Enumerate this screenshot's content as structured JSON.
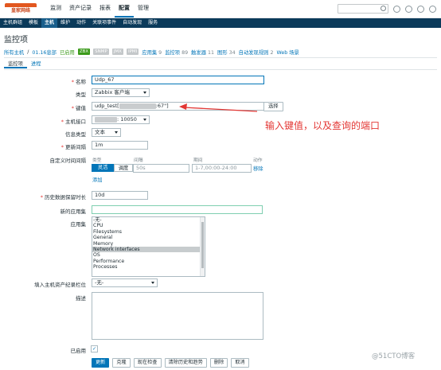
{
  "topbar": {
    "logo_text": "皇家网络",
    "menu": [
      "监测",
      "资产记录",
      "报表",
      "配置",
      "管理"
    ],
    "active_menu": "配置"
  },
  "subnav": [
    "主机群组",
    "模板",
    "主机",
    "维护",
    "动作",
    "关联项事件",
    "自动发现",
    "服务"
  ],
  "subnav_active": "主机",
  "header": {
    "title": "监控项"
  },
  "filter": {
    "all_hosts": "所有主机",
    "sep": "/",
    "host": "01.16息部",
    "status": "已启用",
    "badges": [
      "ZBX",
      "SNMP",
      "JMX",
      "IPMI"
    ],
    "links": [
      {
        "label": "应用集",
        "count": "9"
      },
      {
        "label": "监控项",
        "count": "89"
      },
      {
        "label": "触发器",
        "count": "11"
      },
      {
        "label": "图形",
        "count": "34"
      },
      {
        "label": "自动发现规则",
        "count": "2"
      },
      {
        "label": "Web 场景",
        "count": ""
      }
    ]
  },
  "tabs": [
    "监控项",
    "进程"
  ],
  "form": {
    "name_label": "名称",
    "name_value": "Udp_67",
    "type_label": "类型",
    "type_value": "Zabbix 客户端",
    "key_label": "键值",
    "key_prefix": "udp_test[",
    "key_suffix": ":67\"]",
    "select_button": "选择",
    "interface_label": "主机接口",
    "interface_suffix": ": 10050",
    "info_type_label": "信息类型",
    "info_type_value": "文本",
    "interval_label": "更新间隔",
    "interval_value": "1m",
    "custom_label": "自定义时间间隔",
    "custom_headers": [
      "类型",
      "间隔",
      "期间",
      "动作"
    ],
    "custom_seg": [
      "灵活",
      "调度"
    ],
    "custom_interval_placeholder": "50s",
    "custom_period_placeholder": "1-7,00:00-24:00",
    "remove_link": "移除",
    "add_link": "添加",
    "history_label": "历史数据保留时长",
    "history_value": "10d",
    "new_app_label": "新的应用集",
    "apps_label": "应用集",
    "apps": [
      "-无-",
      "CPU",
      "Filesystems",
      "General",
      "Memory",
      "Network interfaces",
      "OS",
      "Performance",
      "Processes"
    ],
    "apps_selected": "Network interfaces",
    "inventory_label": "填入主机资产纪录栏位",
    "inventory_value": "-无-",
    "desc_label": "描述",
    "enabled_label": "已启用"
  },
  "actions": [
    "更新",
    "克隆",
    "现在检查",
    "清除历史和趋势",
    "删除",
    "取消"
  ],
  "annotation": "输入键值，以及查询的端口",
  "watermark": "@51CTO博客",
  "colors": {
    "accent": "#0275b8",
    "annotation": "#e33734",
    "nav": "#0b3a5a"
  }
}
